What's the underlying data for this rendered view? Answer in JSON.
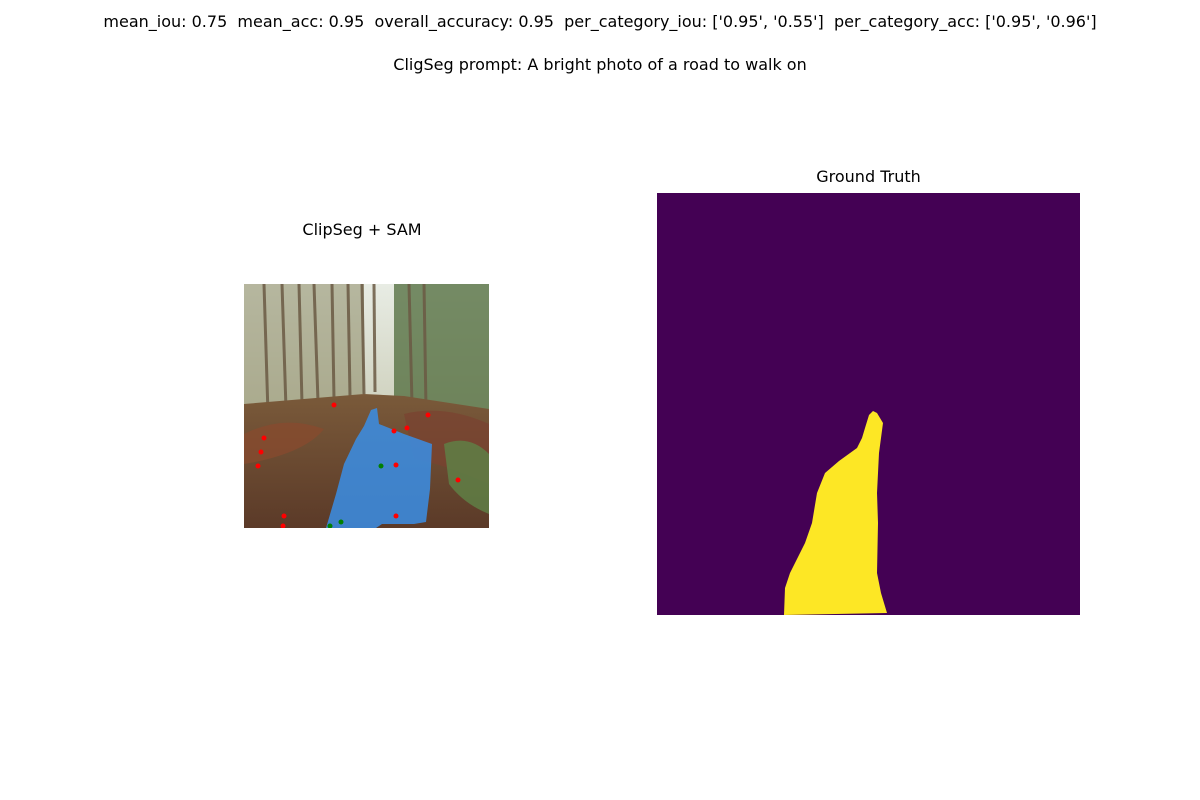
{
  "header": {
    "metrics": "mean_iou: 0.75  mean_acc: 0.95  overall_accuracy: 0.95  per_category_iou: ['0.95', '0.55']  per_category_acc: ['0.95', '0.96']",
    "prompt": "CligSeg prompt: A bright photo of a road to walk on"
  },
  "panels": {
    "left": {
      "title": "ClipSeg + SAM",
      "content": "forest path photo with blue segmentation overlay and point markers",
      "mask_color": "#3a8ee6",
      "negative_point_color": "#ff0000",
      "positive_point_color": "#008000",
      "negative_point_count": 12,
      "positive_point_count": 3
    },
    "right": {
      "title": "Ground Truth",
      "content": "segmentation mask",
      "background_color": "#440154",
      "mask_color": "#fde725"
    }
  }
}
